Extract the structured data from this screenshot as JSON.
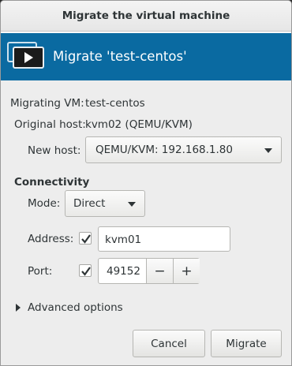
{
  "window": {
    "title": "Migrate the virtual machine"
  },
  "header": {
    "title": "Migrate 'test-centos'",
    "icon": "vm-screen-icon"
  },
  "info": {
    "migrating_vm_label": "Migrating VM:",
    "migrating_vm_value": "test-centos",
    "original_host_label": "Original host:",
    "original_host_value": "kvm02 (QEMU/KVM)",
    "new_host_label": "New host:",
    "new_host_value": "QEMU/KVM: 192.168.1.80"
  },
  "connectivity": {
    "heading": "Connectivity",
    "mode_label": "Mode:",
    "mode_value": "Direct",
    "address_label": "Address:",
    "address_checked": true,
    "address_value": "kvm01",
    "port_label": "Port:",
    "port_checked": true,
    "port_value": "49152",
    "decrement": "−",
    "increment": "+"
  },
  "advanced": {
    "label": "Advanced options",
    "expanded": false
  },
  "buttons": {
    "cancel": "Cancel",
    "migrate": "Migrate"
  },
  "colors": {
    "header_bg": "#0a6aa1",
    "window_bg": "#ededed"
  }
}
